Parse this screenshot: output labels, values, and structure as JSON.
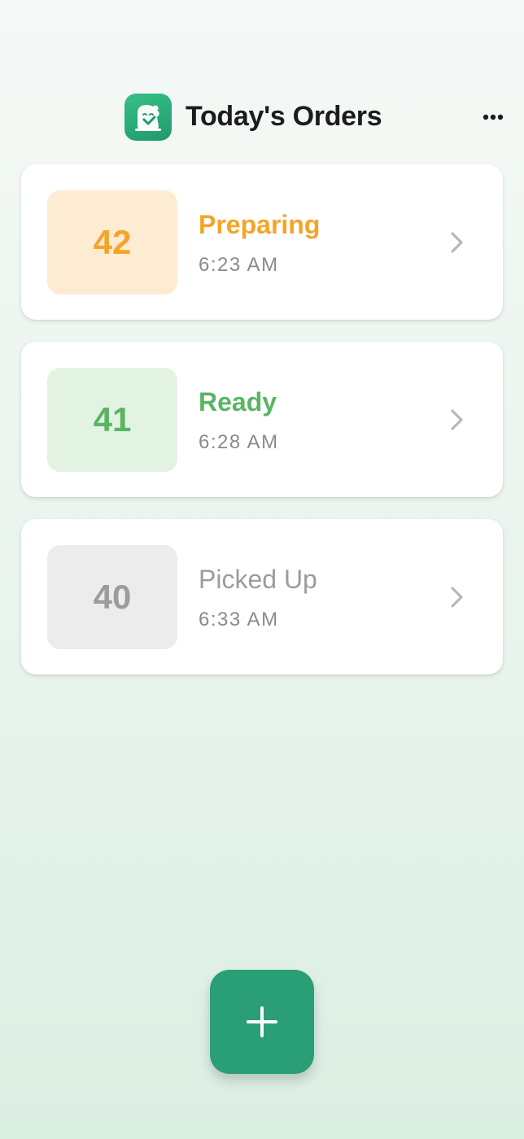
{
  "header": {
    "title": "Today's Orders",
    "logo_icon": "app-logo-icon",
    "more_icon": "more-horizontal-icon"
  },
  "orders": [
    {
      "number": "42",
      "status": "Preparing",
      "time": "6:23 AM",
      "status_color": "#f5a42a",
      "box_color": "#fdebd2"
    },
    {
      "number": "41",
      "status": "Ready",
      "time": "6:28 AM",
      "status_color": "#5bb464",
      "box_color": "#e2f3e2"
    },
    {
      "number": "40",
      "status": "Picked Up",
      "time": "6:33 AM",
      "status_color": "#9c9c9c",
      "box_color": "#ececec"
    }
  ],
  "fab": {
    "icon": "plus-icon",
    "color": "#2a9e77"
  },
  "colors": {
    "accent": "#2a9e77",
    "chevron": "#b8b8b8"
  }
}
